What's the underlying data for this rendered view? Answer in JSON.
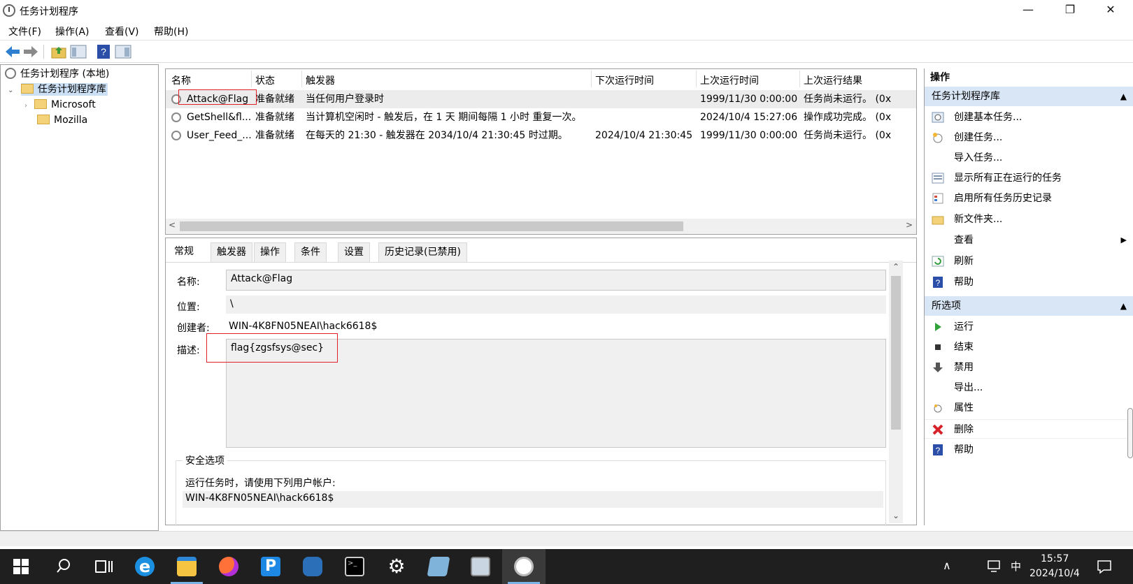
{
  "window": {
    "title": "任务计划程序",
    "minimize": "—",
    "maximize": "❐",
    "close": "✕"
  },
  "menu": [
    "文件(F)",
    "操作(A)",
    "查看(V)",
    "帮助(H)"
  ],
  "toolbar": {
    "icons": [
      "back-arrow-icon",
      "forward-arrow-icon",
      "folder-up-icon",
      "show-hide-console-tree-icon",
      "help-icon",
      "show-hide-action-pane-icon"
    ]
  },
  "tree": {
    "root": "任务计划程序 (本地)",
    "library": "任务计划程序库",
    "children": [
      "Microsoft",
      "Mozilla"
    ]
  },
  "task_table": {
    "columns": [
      "名称",
      "状态",
      "触发器",
      "下次运行时间",
      "上次运行时间",
      "上次运行结果"
    ],
    "rows": [
      {
        "name": "Attack@Flag",
        "status": "准备就绪",
        "trigger": "当任何用户登录时",
        "next": "",
        "last": "1999/11/30 0:00:00",
        "result": "任务尚未运行。 (0x"
      },
      {
        "name": "GetShell&fl...",
        "status": "准备就绪",
        "trigger": "当计算机空闲时 - 触发后，在 1 天 期间每隔 1 小时 重复一次。",
        "next": "",
        "last": "2024/10/4 15:27:06",
        "result": "操作成功完成。 (0x"
      },
      {
        "name": "User_Feed_...",
        "status": "准备就绪",
        "trigger": "在每天的 21:30 - 触发器在 2034/10/4 21:30:45 时过期。",
        "next": "2024/10/4 21:30:45",
        "last": "1999/11/30 0:00:00",
        "result": "任务尚未运行。 (0x"
      }
    ],
    "scroll_left": "<",
    "scroll_right": ">"
  },
  "detail": {
    "tabs": [
      "常规",
      "触发器",
      "操作",
      "条件",
      "设置",
      "历史记录(已禁用)"
    ],
    "name_label": "名称:",
    "name_value": "Attack@Flag",
    "location_label": "位置:",
    "location_value": "\\",
    "author_label": "创建者:",
    "author_value": "WIN-4K8FN05NEAI\\hack6618$",
    "desc_label": "描述:",
    "desc_value": "flag{zgsfsys@sec}",
    "security_legend": "安全选项",
    "run_as_label": "运行任务时，请使用下列用户帐户:",
    "run_as_value": "WIN-4K8FN05NEAI\\hack6618$",
    "scroll_up": "⌃",
    "scroll_down": "⌄"
  },
  "actions": {
    "title": "操作",
    "section1": "任务计划程序库",
    "items1": [
      {
        "label": "创建基本任务...",
        "icon": "create-basic-task-icon"
      },
      {
        "label": "创建任务...",
        "icon": "create-task-icon"
      },
      {
        "label": "导入任务...",
        "icon": ""
      },
      {
        "label": "显示所有正在运行的任务",
        "icon": "running-tasks-icon"
      },
      {
        "label": "启用所有任务历史记录",
        "icon": "history-icon"
      },
      {
        "label": "新文件夹...",
        "icon": "new-folder-icon"
      },
      {
        "label": "查看",
        "icon": ""
      },
      {
        "label": "刷新",
        "icon": "refresh-icon"
      },
      {
        "label": "帮助",
        "icon": "help-icon"
      }
    ],
    "section2": "所选项",
    "items2": [
      {
        "label": "运行",
        "icon": "run-icon"
      },
      {
        "label": "结束",
        "icon": "end-icon"
      },
      {
        "label": "禁用",
        "icon": "disable-icon"
      },
      {
        "label": "导出...",
        "icon": ""
      },
      {
        "label": "属性",
        "icon": "properties-icon"
      },
      {
        "label": "删除",
        "icon": "delete-icon"
      },
      {
        "label": "帮助",
        "icon": "help-icon"
      }
    ]
  },
  "taskbar": {
    "apps": [
      "start-icon",
      "search-icon",
      "task-view-icon",
      "internet-explorer-icon",
      "file-explorer-icon",
      "firefox-icon",
      "p-app-icon",
      "network-app-icon",
      "cmd-icon",
      "settings-icon",
      "notepad-icon",
      "network-monitor-icon",
      "task-scheduler-icon"
    ],
    "tray_chevron": "∧",
    "ime": "中",
    "time": "15:57",
    "date": "2024/10/4"
  },
  "colors": {
    "accent": "#d9e6f5",
    "taskbar": "#1f1f1f",
    "highlight_red": "#e0202a"
  }
}
